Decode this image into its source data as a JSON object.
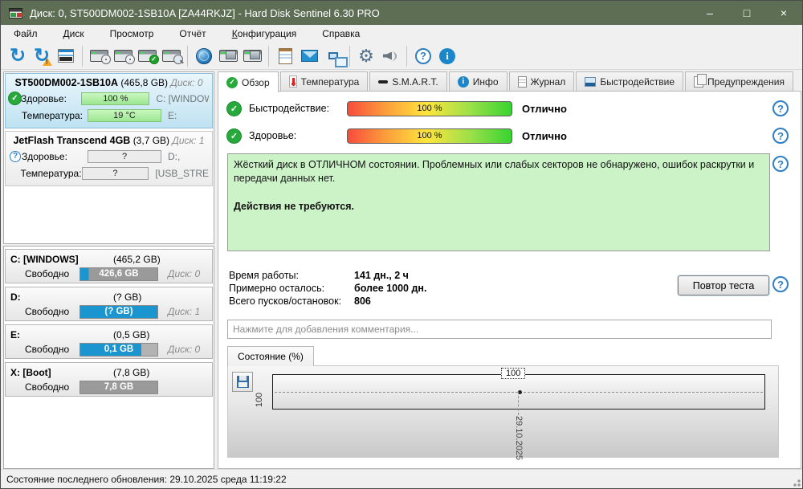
{
  "window": {
    "title": "Диск: 0, ST500DM002-1SB10A [ZA44RKJZ]  -  Hard Disk Sentinel 6.30 PRO",
    "controls": {
      "minimize": "–",
      "maximize": "□",
      "close": "×"
    }
  },
  "menu": {
    "items": [
      "Файл",
      "Диск",
      "Просмотр",
      "Отчёт",
      "Конфигурация",
      "Справка"
    ]
  },
  "toolbar": {
    "buttons": [
      "refresh-icon",
      "refresh-warning-icon",
      "report-icon",
      "disk-gauge-icon",
      "disk-clock-icon",
      "disk-check-icon",
      "disk-search-icon",
      "network-disk-icon",
      "disk-copy-icon",
      "disk-eject-icon",
      "notepad-icon",
      "mail-icon",
      "network-icon",
      "settings-gear-icon",
      "sound-icon",
      "help-icon",
      "info-icon"
    ]
  },
  "sidebar": {
    "disks": [
      {
        "model": "ST500DM002-1SB10A",
        "size": "(465,8 GB)",
        "disk": "Диск: 0",
        "health_label": "Здоровье:",
        "health": "100 %",
        "temp_label": "Температура:",
        "temp": "19 °C",
        "vol1": "C: [WINDOW",
        "vol2": "E:",
        "status": "ok"
      },
      {
        "model": "JetFlash Transcend 4GB",
        "size": "(3,7 GB)",
        "disk": "Диск: 1",
        "health_label": "Здоровье:",
        "health": "?",
        "temp_label": "Температура:",
        "temp": "?",
        "vol1": "D:,",
        "vol2": "[USB_STREL",
        "status": "unknown",
        "unknown_mark": "?"
      }
    ],
    "partitions": [
      {
        "name": "C: [WINDOWS]",
        "size": "(465,2 GB)",
        "free_label": "Свободно",
        "free": "426,6 GB",
        "disk": "Диск: 0"
      },
      {
        "name": "D:",
        "size": "(? GB)",
        "free_label": "Свободно",
        "free": "(? GB)",
        "disk": "Диск: 1"
      },
      {
        "name": "E:",
        "size": "(0,5 GB)",
        "free_label": "Свободно",
        "free": "0,1 GB",
        "disk": "Диск: 0"
      },
      {
        "name": "X: [Boot]",
        "size": "(7,8 GB)",
        "free_label": "Свободно",
        "free": "7,8 GB",
        "disk": ""
      }
    ]
  },
  "tabs": {
    "items": [
      {
        "label": "Обзор",
        "active": true
      },
      {
        "label": "Температура",
        "active": false
      },
      {
        "label": "S.M.A.R.T.",
        "active": false
      },
      {
        "label": "Инфо",
        "active": false
      },
      {
        "label": "Журнал",
        "active": false
      },
      {
        "label": "Быстродействие",
        "active": false
      },
      {
        "label": "Предупреждения",
        "active": false
      }
    ]
  },
  "overview": {
    "rows": [
      {
        "label": "Быстродействие:",
        "value": "100 %",
        "status": "Отлично"
      },
      {
        "label": "Здоровье:",
        "value": "100 %",
        "status": "Отлично"
      }
    ],
    "message_line1": "Жёсткий диск в ОТЛИЧНОМ состоянии. Проблемных или слабых секторов не обнаружено, ошибок раскрутки и передачи данных нет.",
    "message_line2": "Действия не требуются.",
    "stats": [
      {
        "label": "Время работы:",
        "value": "141 дн., 2 ч"
      },
      {
        "label": "Примерно осталось:",
        "value": "более 1000 дн."
      },
      {
        "label": "Всего пусков/остановок:",
        "value": "806"
      }
    ],
    "retest_button": "Повтор теста",
    "comment_placeholder": "Нажмите для добавления комментария...",
    "history_tab": "Состояние (%)"
  },
  "chart_data": {
    "type": "line",
    "title": "Состояние (%)",
    "x": [
      "29.10.2025"
    ],
    "values": [
      100
    ],
    "point_label": "100",
    "y_tick": "100",
    "x_tick": "29.10.2025",
    "grid": "dashed-horizontal",
    "legend": "none"
  },
  "statusbar": {
    "text": "Состояние последнего обновления: 29.10.2025 среда 11:19:22"
  },
  "colors": {
    "titlebar": "#5d6e55",
    "accent_blue": "#1b95d0",
    "health_green_bar": "#9ce692",
    "ok_green": "#27a93c",
    "message_green": "#ccf3c7"
  }
}
